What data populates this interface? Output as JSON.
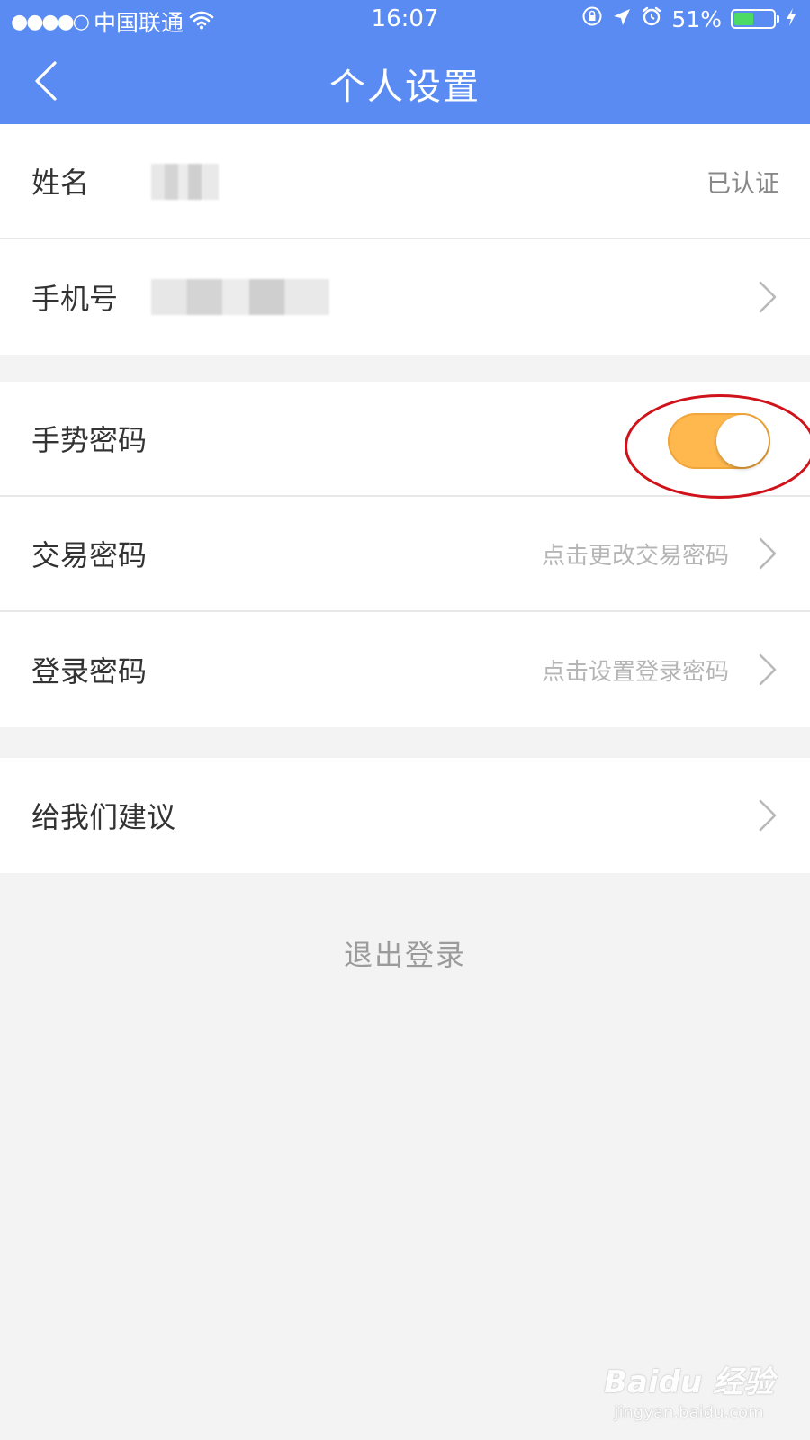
{
  "status_bar": {
    "signal": "●●●●○",
    "carrier": "中国联通",
    "time": "16:07",
    "battery_text": "51%",
    "battery_level": 0.51
  },
  "nav": {
    "title": "个人设置"
  },
  "group_profile": {
    "name_label": "姓名",
    "name_status": "已认证",
    "phone_label": "手机号"
  },
  "group_security": {
    "gesture_label": "手势密码",
    "gesture_enabled": true,
    "trade_label": "交易密码",
    "trade_hint": "点击更改交易密码",
    "login_label": "登录密码",
    "login_hint": "点击设置登录密码"
  },
  "group_feedback": {
    "feedback_label": "给我们建议"
  },
  "logout_label": "退出登录",
  "watermark": {
    "main": "Baidu 经验",
    "sub": "jingyan.baidu.com"
  },
  "colors": {
    "header_bg": "#5a8bf2",
    "toggle_on": "#ffb84d",
    "highlight": "#d0131a",
    "battery_fill": "#4cd964"
  }
}
